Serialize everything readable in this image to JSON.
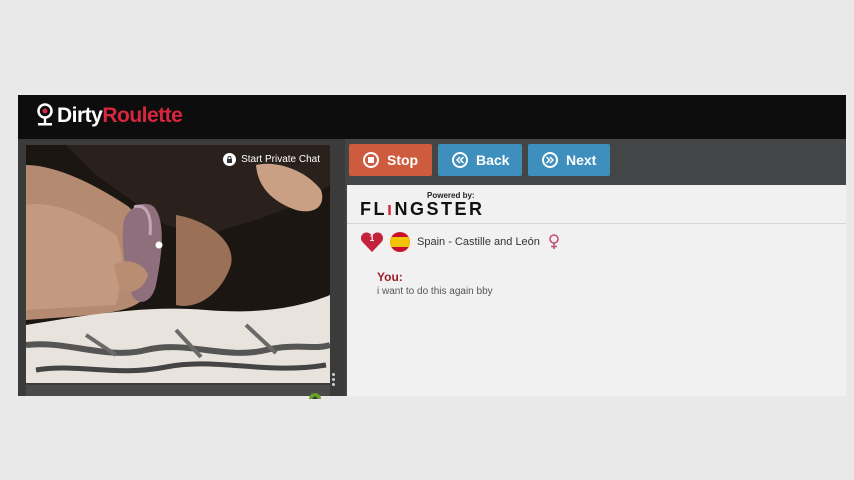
{
  "app": {
    "logo_part1": "Dirty",
    "logo_part2": "Roulette"
  },
  "video": {
    "private_chat_label": "Start Private Chat"
  },
  "toolbar": {
    "stop_label": "Stop",
    "back_label": "Back",
    "next_label": "Next"
  },
  "chat": {
    "powered_by": "Powered by:",
    "brand_prefix": "FL",
    "brand_suffix": "NGSTER",
    "partner": {
      "likes": "1",
      "location": "Spain - Castille and León",
      "flag": "spain-flag-icon",
      "gender": "female-icon"
    },
    "messages": [
      {
        "sender": "You:",
        "text": "i want to do this again bby"
      }
    ]
  },
  "colors": {
    "accent_red": "#d7263d",
    "stop_button": "#cf5b3f",
    "nav_button": "#3e8fbd",
    "sender_label": "#a01d2a"
  }
}
